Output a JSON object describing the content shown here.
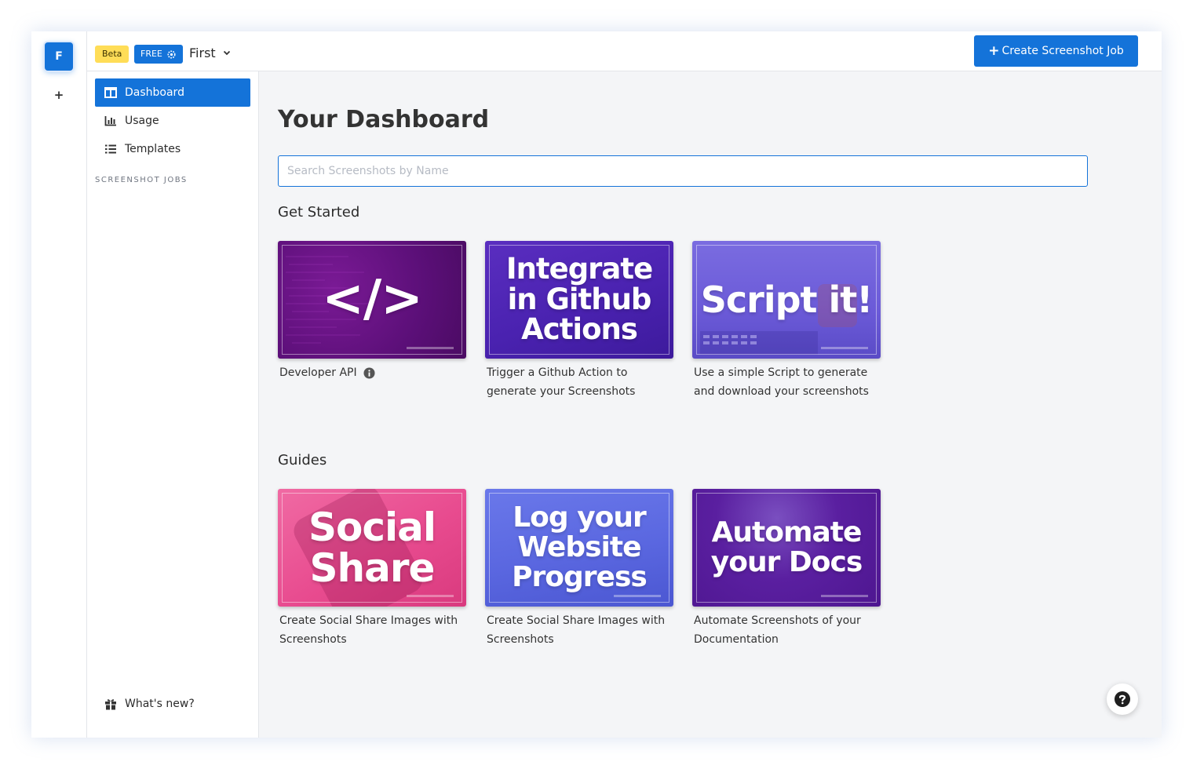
{
  "org": {
    "initial": "F",
    "add_label": "+"
  },
  "topbar": {
    "beta_label": "Beta",
    "plan_label": "FREE",
    "team_name": "First",
    "create_plus": "+",
    "create_label": "Create Screenshot Job"
  },
  "sidebar": {
    "items": [
      {
        "label": "Dashboard",
        "icon": "columns-icon",
        "active": true
      },
      {
        "label": "Usage",
        "icon": "bar-chart-icon",
        "active": false
      },
      {
        "label": "Templates",
        "icon": "list-icon",
        "active": false
      }
    ],
    "section_label": "SCREENSHOT JOBS",
    "whats_new": "What's new?"
  },
  "main": {
    "title": "Your Dashboard",
    "search_placeholder": "Search Screenshots by Name",
    "get_started_title": "Get Started",
    "get_started": [
      {
        "thumb_text": "</>",
        "caption": "Developer API",
        "info_icon": true,
        "color": "#5b0f78"
      },
      {
        "thumb_text": "Integrate in Github Actions",
        "caption": "Trigger a Github Action to generate your Screenshots",
        "color": "#4a22b0"
      },
      {
        "thumb_text": "Script it!",
        "caption": "Use a simple Script to generate and download your screenshots",
        "color": "#6b5ad8"
      }
    ],
    "guides_title": "Guides",
    "guides": [
      {
        "thumb_text": "Social Share",
        "caption": "Create Social Share Images with Screenshots",
        "color": "#e84b8f"
      },
      {
        "thumb_text": "Log your Website Progress",
        "caption": "Create Social Share Images with Screenshots",
        "color": "#5a67e0"
      },
      {
        "thumb_text": "Automate your Docs",
        "caption": "Automate Screenshots of your Documentation",
        "color": "#4e1690"
      }
    ]
  },
  "colors": {
    "accent": "#1473d9",
    "beta": "#ffdd57"
  }
}
